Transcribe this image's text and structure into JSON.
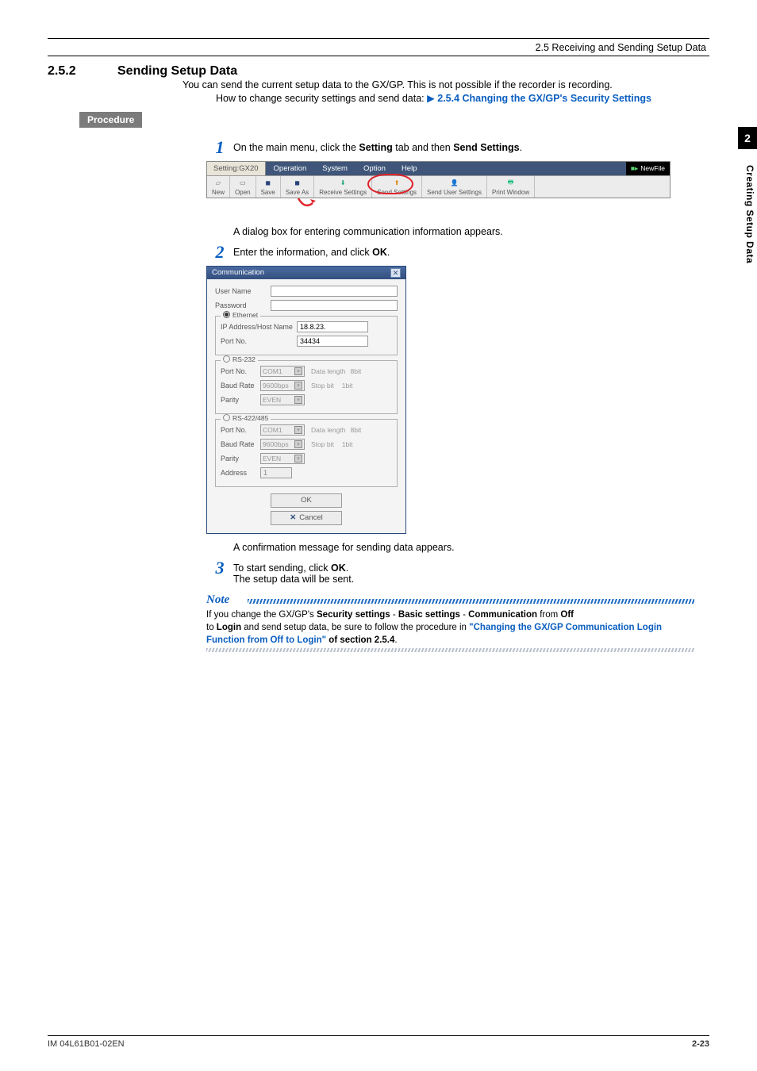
{
  "header": {
    "crumb": "2.5  Receiving and Sending Setup Data"
  },
  "section": {
    "number": "2.5.2",
    "title": "Sending Setup Data"
  },
  "intro": {
    "para": "You can send the current setup data to the GX/GP. This is not possible if the recorder is recording.",
    "how_prefix": "How to change security settings and send data: ",
    "how_link": "2.5.4 Changing the GX/GP's Security Settings"
  },
  "procedure_label": "Procedure",
  "steps": {
    "s1_num": "1",
    "s1_text_a": "On the main menu, click the ",
    "s1_b1": "Setting",
    "s1_text_b": " tab and then ",
    "s1_b2": "Send Settings",
    "s1_text_c": ".",
    "below_toolbar": "A dialog box for entering communication information appears.",
    "s2_num": "2",
    "s2_text_a": "Enter the information, and click ",
    "s2_b1": "OK",
    "s2_text_b": ".",
    "below_dialog": "A confirmation message for sending data appears.",
    "s3_num": "3",
    "s3_text_a": "To start sending, click ",
    "s3_b1": "OK",
    "s3_text_b": ".",
    "s3_line2": "The setup data will be sent."
  },
  "toolbar": {
    "tab_setting": "Setting:GX20",
    "menu": {
      "op": "Operation",
      "sys": "System",
      "opt": "Option",
      "help": "Help"
    },
    "right": "NewFile",
    "items": {
      "new": "New",
      "open": "Open",
      "save": "Save",
      "saveas": "Save As",
      "recv": "Receive Settings",
      "send": "Send Settings",
      "sendu": "Send User Settings",
      "print": "Print Window"
    }
  },
  "dialog": {
    "title": "Communication",
    "user": "User Name",
    "pass": "Password",
    "eth_label": "Ethernet",
    "ip_label": "IP Address/Host Name",
    "ip_val": "18.8.23.",
    "port_label": "Port No.",
    "port_val": "34434",
    "rs232_label": "RS-232",
    "rs485_label": "RS-422/485",
    "pn": "Port No.",
    "pn_val": "COM1",
    "br": "Baud Rate",
    "br_val": "9600bps",
    "parity": "Parity",
    "parity_val": "EVEN",
    "dlen": "Data length",
    "dlen_val": "8bit",
    "sbit": "Stop bit",
    "sbit_val": "1bit",
    "addr": "Address",
    "addr_val": "1",
    "ok": "OK",
    "cancel": "Cancel"
  },
  "note": {
    "label": "Note",
    "t1": "If you change the GX/GP's ",
    "b1": "Security settings",
    "t2": " - ",
    "b2": "Basic settings",
    "t3": " - ",
    "b3": "Communication",
    "t4": " from ",
    "b4": "Off",
    "t5": " to ",
    "b5": "Login",
    "t6": " and send setup data, be sure to follow the procedure in ",
    "link": "\"Changing the GX/GP Communication Login Function from Off to Login\"",
    "t7": " of section 2.5.4",
    "t8": "."
  },
  "side": {
    "chapnum": "2",
    "chapname": "Creating Setup Data"
  },
  "footer": {
    "left": "IM 04L61B01-02EN",
    "right": "2-23"
  }
}
